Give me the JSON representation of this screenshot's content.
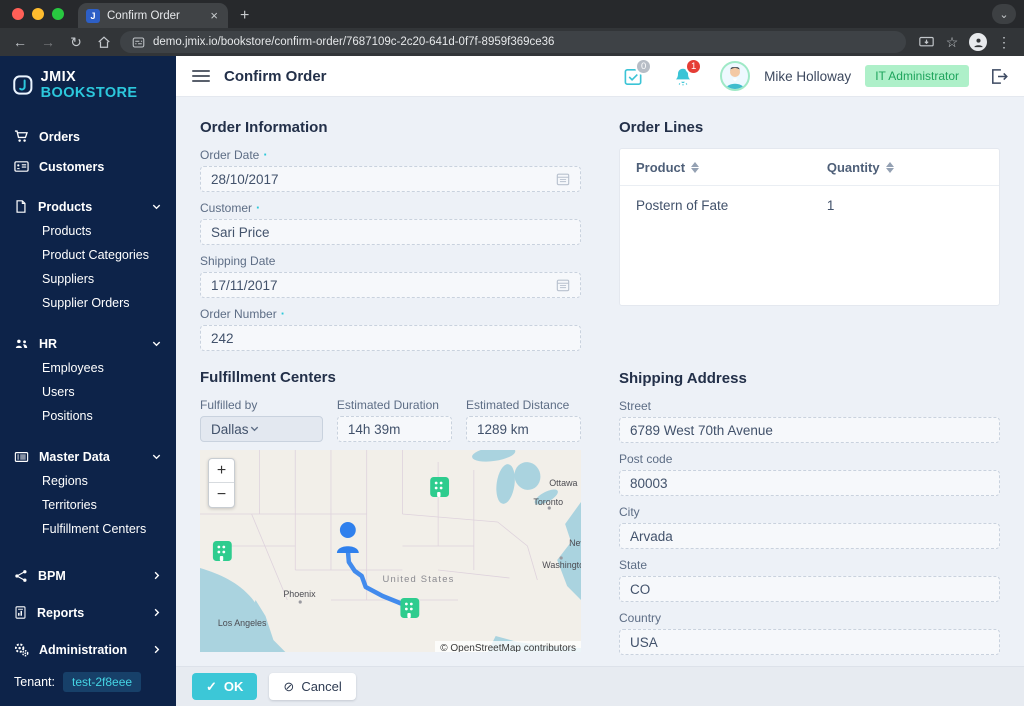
{
  "icons": {
    "back": "←",
    "forward": "→",
    "reload": "↻",
    "star": "☆",
    "menu_dots": "⋮",
    "close_tab": "×",
    "new_tab": "+",
    "tab_search": "⌄",
    "zoom_in": "+",
    "zoom_out": "−",
    "ok_check": "✓",
    "cancel_slash": "⊘"
  },
  "browser": {
    "tab_title": "Confirm Order",
    "url": "demo.jmix.io/bookstore/confirm-order/7687109c-2c20-641d-0f7f-8959f369ce36",
    "favicon_letter": "J"
  },
  "sidebar": {
    "logo_primary": "JMIX",
    "logo_secondary": "BOOKSTORE",
    "items": [
      {
        "label": "Orders"
      },
      {
        "label": "Customers"
      },
      {
        "label": "Products"
      },
      {
        "label": "Products"
      },
      {
        "label": "Product Categories"
      },
      {
        "label": "Suppliers"
      },
      {
        "label": "Supplier Orders"
      },
      {
        "label": "HR"
      },
      {
        "label": "Employees"
      },
      {
        "label": "Users"
      },
      {
        "label": "Positions"
      },
      {
        "label": "Master Data"
      },
      {
        "label": "Regions"
      },
      {
        "label": "Territories"
      },
      {
        "label": "Fulfillment Centers"
      },
      {
        "label": "BPM"
      },
      {
        "label": "Reports"
      },
      {
        "label": "Administration"
      }
    ],
    "tenant_label": "Tenant:",
    "tenant_value": "test-2f8eee"
  },
  "header": {
    "title": "Confirm Order",
    "messages_count": "0",
    "notifications_count": "1",
    "user_name": "Mike Holloway",
    "user_role": "IT Administrator"
  },
  "order_information": {
    "title": "Order Information",
    "order_date_label": "Order Date",
    "order_date_value": "28/10/2017",
    "customer_label": "Customer",
    "customer_value": "Sari Price",
    "shipping_date_label": "Shipping Date",
    "shipping_date_value": "17/11/2017",
    "order_number_label": "Order Number",
    "order_number_value": "242"
  },
  "order_lines": {
    "title": "Order Lines",
    "columns": [
      "Product",
      "Quantity"
    ],
    "rows": [
      {
        "product": "Postern of Fate",
        "quantity": "1"
      }
    ]
  },
  "fulfillment": {
    "title": "Fulfillment Centers",
    "fulfilled_by_label": "Fulfilled by",
    "fulfilled_by_value": "Dallas",
    "duration_label": "Estimated Duration",
    "duration_value": "14h 39m",
    "distance_label": "Estimated Distance",
    "distance_value": "1289 km",
    "map": {
      "label_country": "United States",
      "label_los_angeles": "Los Angeles",
      "label_phoenix": "Phoenix",
      "label_toronto": "Toronto",
      "label_ottawa": "Ottawa",
      "label_washington": "Washington",
      "label_new_york": "New York",
      "attribution": "© OpenStreetMap contributors"
    }
  },
  "shipping_address": {
    "title": "Shipping Address",
    "street_label": "Street",
    "street_value": "6789 West 70th Avenue",
    "post_code_label": "Post code",
    "post_code_value": "80003",
    "city_label": "City",
    "city_value": "Arvada",
    "state_label": "State",
    "state_value": "CO",
    "country_label": "Country",
    "country_value": "USA"
  },
  "actions": {
    "ok": "OK",
    "cancel": "Cancel"
  }
}
